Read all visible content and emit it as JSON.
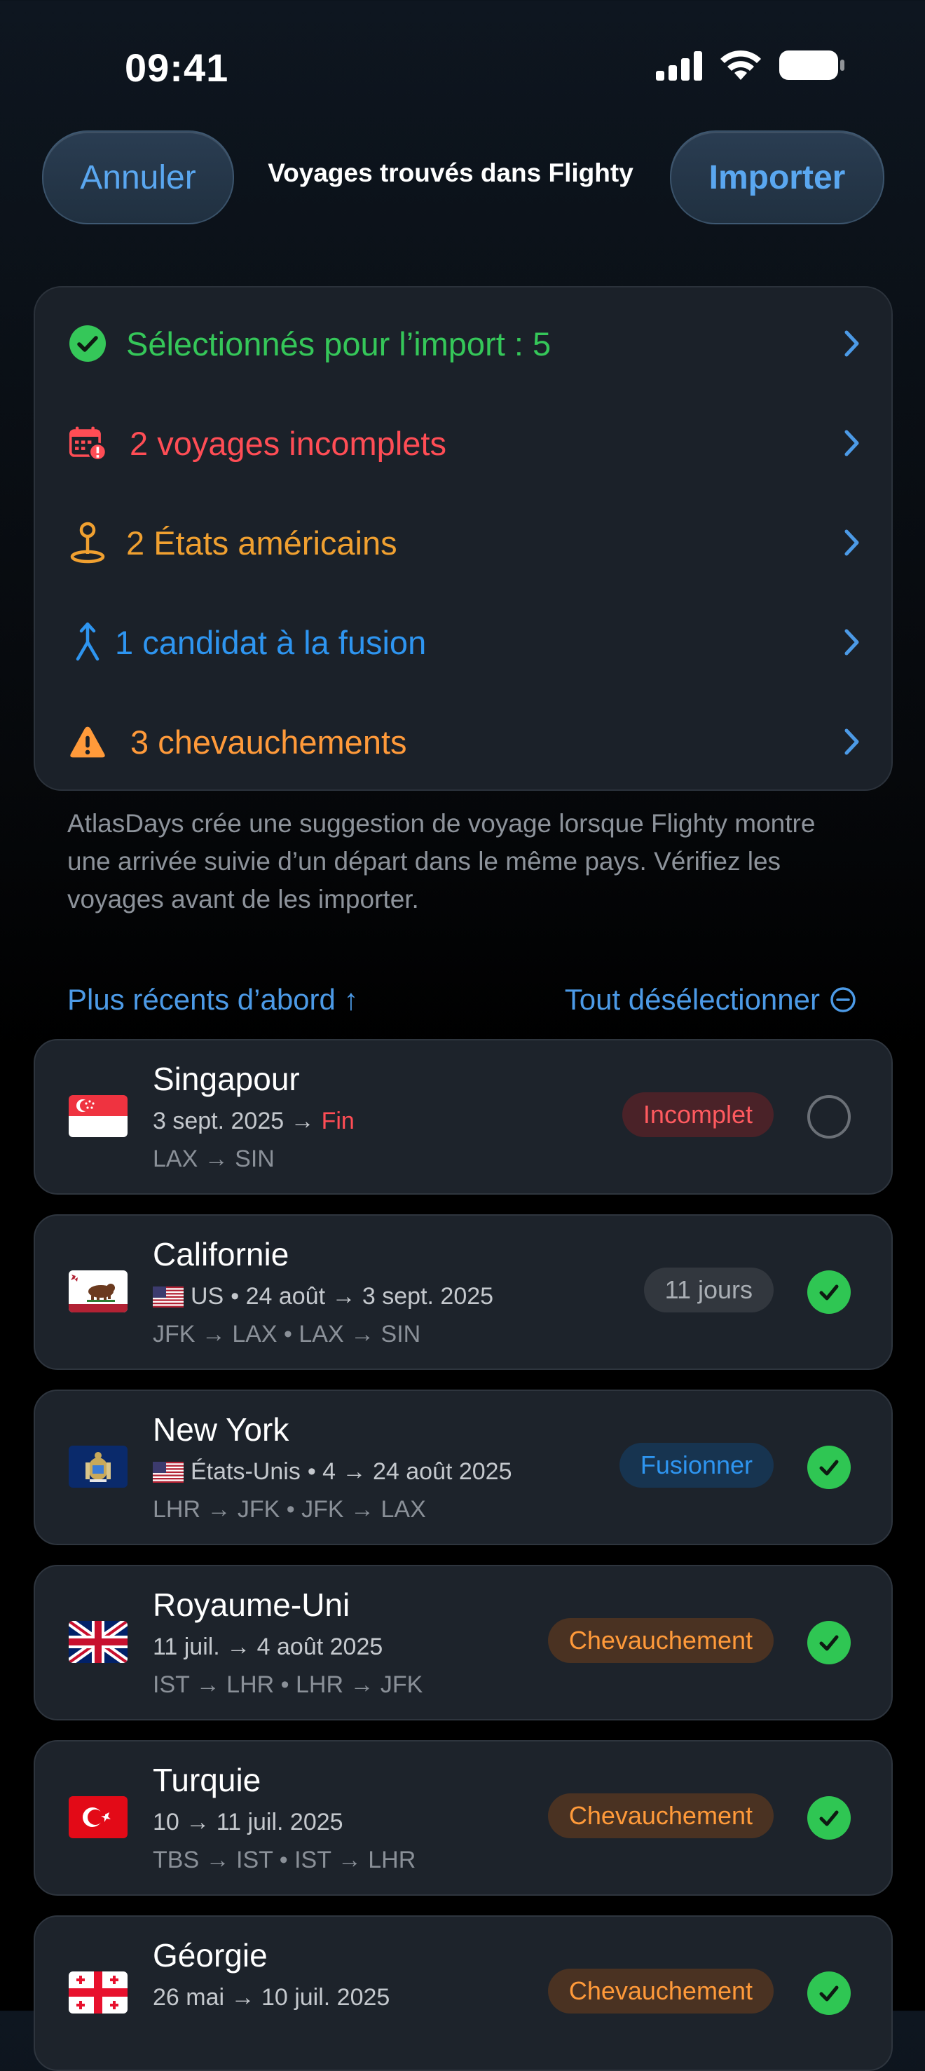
{
  "status_bar": {
    "time": "09:41"
  },
  "nav": {
    "cancel_label": "Annuler",
    "title": "Voyages trouvés dans Flighty",
    "import_label": "Importer"
  },
  "summary": {
    "selected": {
      "label": "Sélectionnés pour l’import : 5",
      "color": "#35c759",
      "icon": "checkmark-circle-icon"
    },
    "incomplete": {
      "label": "2 voyages incomplets",
      "color": "#ff4d55",
      "icon": "calendar-warning-icon"
    },
    "us_states": {
      "label": "2 États américains",
      "color": "#f0a030",
      "icon": "map-pin-icon"
    },
    "merge": {
      "label": "1 candidat à la fusion",
      "color": "#2e95f0",
      "icon": "merge-icon"
    },
    "overlaps": {
      "label": "3 chevauchements",
      "color": "#ff9a3a",
      "icon": "warning-triangle-icon"
    }
  },
  "note": "AtlasDays crée une suggestion de voyage lorsque Flighty montre une arrivée suivie d’un départ dans le même pays. Vérifiez les voyages avant de les importer.",
  "list_controls": {
    "sort_label": "Plus récents d’abord ↑",
    "deselect_label": "Tout désélectionner"
  },
  "trips": [
    {
      "name": "Singapour",
      "dates": "3 sept. 2025 →",
      "dates_end": "Fin",
      "route": "LAX → SIN",
      "badge": "Incomplet",
      "selected": false,
      "flag": "singapore-flag-icon"
    },
    {
      "name": "Californie",
      "country_code": "US",
      "dates": "• 24 août → 3 sept. 2025",
      "route": "JFK → LAX • LAX → SIN",
      "badge": "11 jours",
      "selected": true,
      "flag": "california-flag-icon"
    },
    {
      "name": "New York",
      "country_name": "États-Unis",
      "dates": "• 4 → 24 août 2025",
      "route": "LHR → JFK • JFK → LAX",
      "badge": "Fusionner",
      "selected": true,
      "flag": "new-york-flag-icon"
    },
    {
      "name": "Royaume-Uni",
      "dates": "11 juil. → 4 août 2025",
      "route": "IST → LHR • LHR → JFK",
      "badge": "Chevauchement",
      "selected": true,
      "flag": "uk-flag-icon"
    },
    {
      "name": "Turquie",
      "dates": "10 → 11 juil. 2025",
      "route": "TBS → IST • IST → LHR",
      "badge": "Chevauchement",
      "selected": true,
      "flag": "turkey-flag-icon"
    },
    {
      "name": "Géorgie",
      "dates": "26 mai → 10 juil. 2025",
      "route": "",
      "badge": "Chevauchement",
      "selected": true,
      "flag": "georgia-flag-icon"
    }
  ]
}
